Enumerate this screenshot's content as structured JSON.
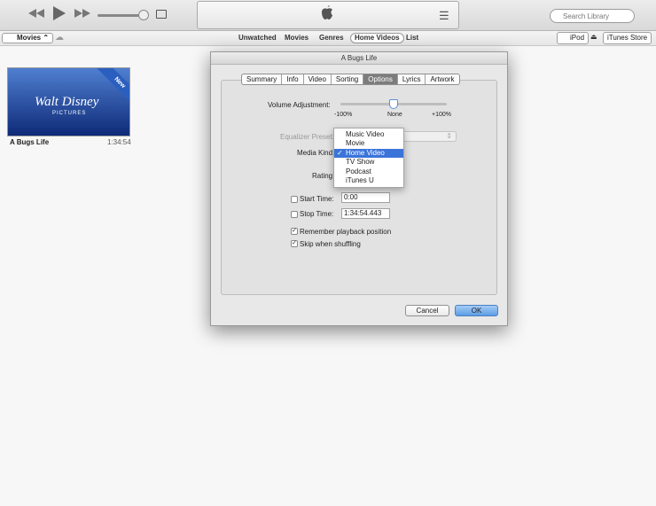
{
  "player": {
    "rewind_icon": "rewind-icon",
    "play_icon": "play-icon",
    "forward_icon": "fast-forward-icon",
    "airplay_icon": "airplay-icon",
    "list_icon": "list-icon"
  },
  "search": {
    "placeholder": "Search Library"
  },
  "library_selector": {
    "label": "Movies"
  },
  "view_tabs": [
    "Unwatched",
    "Movies",
    "Genres",
    "Home Videos",
    "List"
  ],
  "device": {
    "label": "iPod"
  },
  "store_button": {
    "label": "iTunes Store"
  },
  "movie": {
    "title": "A Bugs Life",
    "duration": "1:34:54",
    "badge": "New",
    "poster_logo": "Walt Disney",
    "poster_sub": "PICTURES"
  },
  "dialog": {
    "title": "A Bugs Life",
    "tabs": [
      "Summary",
      "Info",
      "Video",
      "Sorting",
      "Options",
      "Lyrics",
      "Artwork"
    ],
    "selected_tab": "Options",
    "volume_label": "Volume Adjustment:",
    "volume_min": "-100%",
    "volume_mid": "None",
    "volume_max": "+100%",
    "equalizer_label": "Equalizer Preset:",
    "media_kind_label": "Media Kind:",
    "rating_label": "Rating:",
    "media_kind_options": [
      "Music Video",
      "Movie",
      "Home Video",
      "TV Show",
      "Podcast",
      "iTunes U"
    ],
    "media_kind_selected": "Home Video",
    "start_time_label": "Start Time:",
    "start_time_value": "0:00",
    "stop_time_label": "Stop Time:",
    "stop_time_value": "1:34:54.443",
    "remember_label": "Remember playback position",
    "skip_label": "Skip when shuffling",
    "cancel_label": "Cancel",
    "ok_label": "OK"
  },
  "colors": {
    "accent": "#3b74d9",
    "poster": "#1e4aa0"
  }
}
